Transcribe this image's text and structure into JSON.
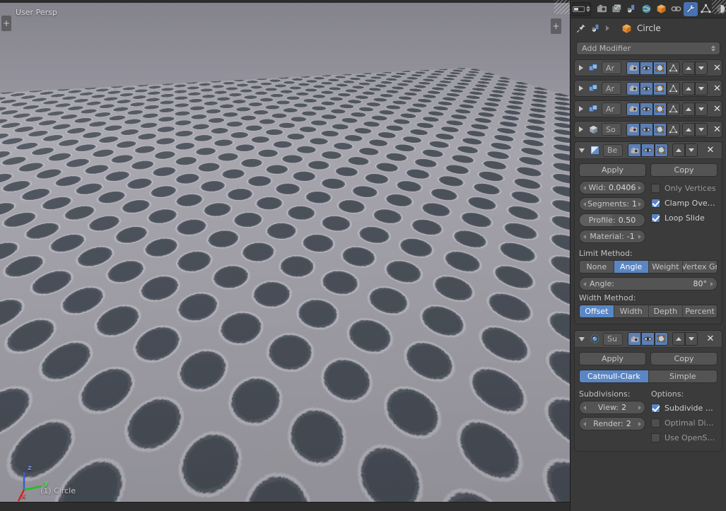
{
  "viewport": {
    "perspective_label": "User Persp",
    "object_label": "(1) Circle",
    "axis": {
      "x": "x",
      "y": "y",
      "z": "z"
    },
    "panel_toggle": "+",
    "panel_toggle_right": "+"
  },
  "properties": {
    "header": {
      "tabs": [
        {
          "name": "render-tab",
          "icon": "camera-icon",
          "active": false
        },
        {
          "name": "output-tab",
          "icon": "printer-icon",
          "active": false
        },
        {
          "name": "scene-tab",
          "icon": "scene-icon",
          "active": false
        },
        {
          "name": "world-tab",
          "icon": "world-globe-icon",
          "active": false
        },
        {
          "name": "object-tab",
          "icon": "orange-cube-icon",
          "active": false
        },
        {
          "name": "constraints-tab",
          "icon": "chain-link-icon",
          "active": false
        },
        {
          "name": "modifiers-tab",
          "icon": "wrench-icon",
          "active": true
        },
        {
          "name": "data-tab",
          "icon": "green-triangle-mesh-icon",
          "active": false
        },
        {
          "name": "material-tab",
          "icon": "material-sphere-icon",
          "active": false
        }
      ]
    },
    "breadcrumb": {
      "pin_icon": "pin-icon",
      "scene_icon": "scene-icon",
      "object_icon": "orange-cube-icon",
      "object_name": "Circle"
    },
    "add_modifier": "Add Modifier",
    "modifiers": [
      {
        "id": "array-1",
        "expanded": false,
        "icon": "array-modifier-icon",
        "name": "Ar",
        "toggles": [
          {
            "name": "render-toggle",
            "icon": "camera-icon",
            "on": true
          },
          {
            "name": "realtime-toggle",
            "icon": "eye-icon",
            "on": true
          },
          {
            "name": "edit-mode-toggle",
            "icon": "edit-mode-icon",
            "on": true
          },
          {
            "name": "on-cage-toggle",
            "icon": "cage-icon",
            "on": false
          }
        ]
      },
      {
        "id": "array-2",
        "expanded": false,
        "icon": "array-modifier-icon",
        "name": "Ar",
        "toggles": [
          {
            "name": "render-toggle",
            "icon": "camera-icon",
            "on": true
          },
          {
            "name": "realtime-toggle",
            "icon": "eye-icon",
            "on": true
          },
          {
            "name": "edit-mode-toggle",
            "icon": "edit-mode-icon",
            "on": true
          },
          {
            "name": "on-cage-toggle",
            "icon": "cage-icon",
            "on": false
          }
        ]
      },
      {
        "id": "array-3",
        "expanded": false,
        "icon": "array-modifier-icon",
        "name": "Ar",
        "toggles": [
          {
            "name": "render-toggle",
            "icon": "camera-icon",
            "on": true
          },
          {
            "name": "realtime-toggle",
            "icon": "eye-icon",
            "on": true
          },
          {
            "name": "edit-mode-toggle",
            "icon": "edit-mode-icon",
            "on": true
          },
          {
            "name": "on-cage-toggle",
            "icon": "cage-icon",
            "on": false
          }
        ]
      },
      {
        "id": "solidify-1",
        "expanded": false,
        "icon": "solidify-modifier-icon",
        "name": "So",
        "toggles": [
          {
            "name": "render-toggle",
            "icon": "camera-icon",
            "on": true
          },
          {
            "name": "realtime-toggle",
            "icon": "eye-icon",
            "on": true
          },
          {
            "name": "edit-mode-toggle",
            "icon": "edit-mode-icon",
            "on": true
          },
          {
            "name": "on-cage-toggle",
            "icon": "cage-icon",
            "on": false
          }
        ]
      }
    ],
    "bevel": {
      "expanded": true,
      "icon": "bevel-modifier-icon",
      "name": "Be",
      "toggles": [
        {
          "name": "render-toggle",
          "icon": "camera-icon",
          "on": true
        },
        {
          "name": "realtime-toggle",
          "icon": "eye-icon",
          "on": true
        },
        {
          "name": "edit-mode-toggle",
          "icon": "edit-mode-icon",
          "on": true
        }
      ],
      "apply_label": "Apply",
      "copy_label": "Copy",
      "width_label": "Wid:",
      "width_value": "0.0406",
      "segments_label": "Segments:",
      "segments_value": "1",
      "profile_label": "Profile:",
      "profile_value": "0.50",
      "material_label": "Material:",
      "material_value": "-1",
      "only_vertices_label": "Only Vertices",
      "only_vertices_checked": false,
      "clamp_overlap_label": "Clamp Over…",
      "clamp_overlap_checked": true,
      "loop_slide_label": "Loop Slide",
      "loop_slide_checked": true,
      "limit_method_label": "Limit Method:",
      "limit_method_options": [
        "None",
        "Angle",
        "Weight",
        "Vertex Gr"
      ],
      "limit_method_selected": "Angle",
      "angle_label": "Angle:",
      "angle_value": "80°",
      "width_method_label": "Width Method:",
      "width_method_options": [
        "Offset",
        "Width",
        "Depth",
        "Percent"
      ],
      "width_method_selected": "Offset"
    },
    "subsurf": {
      "expanded": true,
      "icon": "subsurf-modifier-icon",
      "name": "Su",
      "toggles": [
        {
          "name": "render-toggle",
          "icon": "camera-icon",
          "on": true
        },
        {
          "name": "realtime-toggle",
          "icon": "eye-icon",
          "on": true
        },
        {
          "name": "edit-mode-toggle",
          "icon": "edit-mode-icon",
          "on": true
        }
      ],
      "apply_label": "Apply",
      "copy_label": "Copy",
      "algorithm_options": [
        "Catmull-Clark",
        "Simple"
      ],
      "algorithm_selected": "Catmull-Clark",
      "subdivisions_label": "Subdivisions:",
      "view_label": "View:",
      "view_value": "2",
      "render_label": "Render:",
      "render_value": "2",
      "options_label": "Options:",
      "subdivide_uvs_label": "Subdivide U…",
      "subdivide_uvs_checked": true,
      "optimal_display_label": "Optimal Dis…",
      "optimal_display_checked": false,
      "use_opensubdiv_label": "Use OpenSu…",
      "use_opensubdiv_checked": false
    }
  },
  "colors": {
    "accent_blue": "#5b86c4",
    "panel_bg": "#393939",
    "header_bg": "#303030",
    "button_bg": "#545454",
    "surface": "#aba9b2",
    "hole": "#4d535d"
  }
}
